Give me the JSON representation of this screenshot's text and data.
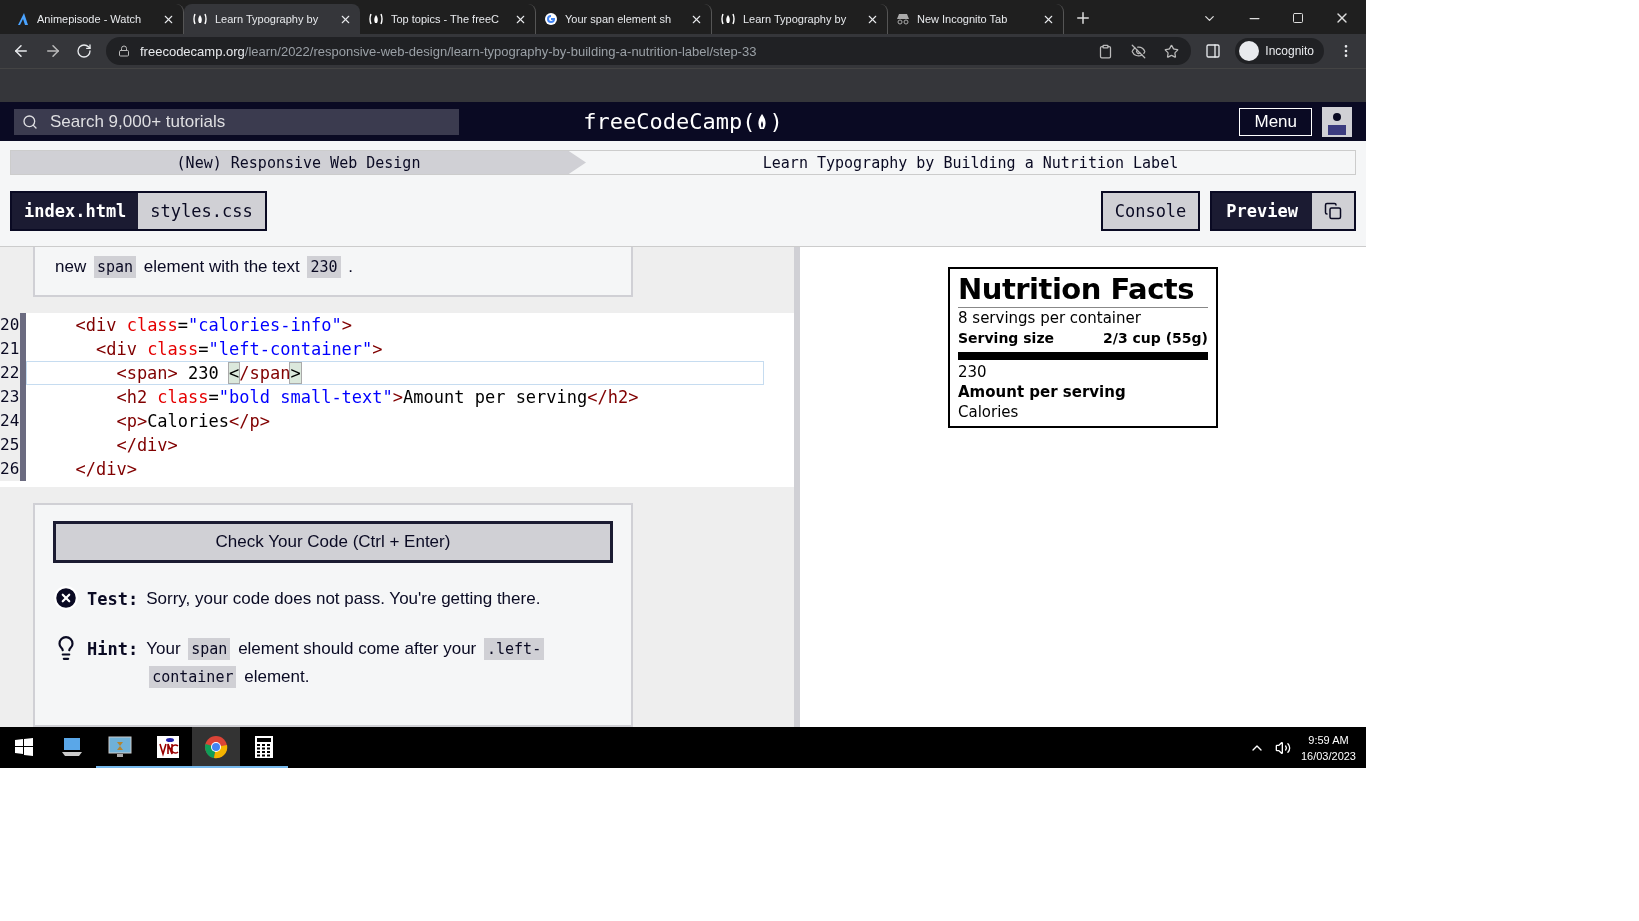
{
  "browser": {
    "tabs": [
      {
        "title": "Animepisode - Watch",
        "kind": "a",
        "selected": false
      },
      {
        "title": "Learn Typography by",
        "kind": "fcc",
        "selected": true
      },
      {
        "title": "Top topics - The freeC",
        "kind": "fcc",
        "selected": false
      },
      {
        "title": "Your span element sh",
        "kind": "g",
        "selected": false
      },
      {
        "title": "Learn Typography by",
        "kind": "fcc",
        "selected": false
      },
      {
        "title": "New Incognito Tab",
        "kind": "incognito",
        "selected": false
      }
    ],
    "url_domain": "freecodecamp.org",
    "url_path": "/learn/2022/responsive-web-design/learn-typography-by-building-a-nutrition-label/step-33",
    "profile": "Incognito"
  },
  "site": {
    "search_placeholder": "Search 9,000+ tutorials",
    "logo": "freeCodeCamp(",
    "logo_close": ")",
    "menu": "Menu"
  },
  "breadcrumb": [
    {
      "label": "(New) Responsive Web Design"
    },
    {
      "label": "Learn Typography by Building a Nutrition Label"
    }
  ],
  "file_tabs": [
    {
      "label": "index.html",
      "selected": true
    },
    {
      "label": "styles.css",
      "selected": false
    }
  ],
  "actions": {
    "console": "Console",
    "preview": "Preview"
  },
  "instructions": {
    "parts": [
      {
        "kind": "text",
        "text": "new"
      },
      {
        "kind": "code",
        "text": "span"
      },
      {
        "kind": "text",
        "text": "element with the text"
      },
      {
        "kind": "code",
        "text": "230"
      },
      {
        "kind": "text",
        "text": "."
      }
    ]
  },
  "code_lines": [
    {
      "number": "20",
      "active": false,
      "tokens": [
        {
          "kind": "tag",
          "text": "  <div"
        },
        {
          "kind": "attr",
          "text": " class"
        },
        {
          "kind": "plain",
          "text": "="
        },
        {
          "kind": "string",
          "text": "\"calories-info\""
        },
        {
          "kind": "tag",
          "text": ">"
        }
      ]
    },
    {
      "number": "21",
      "active": false,
      "tokens": [
        {
          "kind": "tag",
          "text": "    <div"
        },
        {
          "kind": "attr",
          "text": " class"
        },
        {
          "kind": "plain",
          "text": "="
        },
        {
          "kind": "string",
          "text": "\"left-container\""
        },
        {
          "kind": "tag",
          "text": ">"
        }
      ]
    },
    {
      "number": "22",
      "active": true,
      "tokens": [
        {
          "kind": "tag",
          "text": "      <span>"
        },
        {
          "kind": "plain",
          "text": " 230 "
        },
        {
          "kind": "bracket",
          "text": "<"
        },
        {
          "kind": "tag",
          "text": "/span"
        },
        {
          "kind": "bracket",
          "text": ">"
        }
      ]
    },
    {
      "number": "23",
      "active": false,
      "tokens": [
        {
          "kind": "tag",
          "text": "      <h2"
        },
        {
          "kind": "attr",
          "text": " class"
        },
        {
          "kind": "plain",
          "text": "="
        },
        {
          "kind": "string",
          "text": "\"bold small-text\""
        },
        {
          "kind": "tag",
          "text": ">"
        },
        {
          "kind": "plain",
          "text": "Amount per serving"
        },
        {
          "kind": "tag",
          "text": "</h2>"
        }
      ]
    },
    {
      "number": "24",
      "active": false,
      "tokens": [
        {
          "kind": "tag",
          "text": "      <p>"
        },
        {
          "kind": "plain",
          "text": "Calories"
        },
        {
          "kind": "tag",
          "text": "</p>"
        }
      ]
    },
    {
      "number": "25",
      "active": false,
      "tokens": [
        {
          "kind": "tag",
          "text": "      </div>"
        }
      ]
    },
    {
      "number": "26",
      "active": false,
      "tokens": [
        {
          "kind": "tag",
          "text": "  </div>"
        }
      ]
    }
  ],
  "check_button": "Check Your Code (Ctrl + Enter)",
  "feedback": [
    {
      "kind": "test",
      "label": "Test:",
      "parts": [
        {
          "kind": "text",
          "text": "Sorry, your code does not pass. You're getting there."
        }
      ]
    },
    {
      "kind": "hint",
      "label": "Hint:",
      "parts": [
        {
          "kind": "text",
          "text": "Your"
        },
        {
          "kind": "code",
          "text": "span"
        },
        {
          "kind": "text",
          "text": "element should come after your"
        },
        {
          "kind": "code",
          "text": ".left-"
        },
        {
          "kind": "code",
          "text": "container"
        },
        {
          "kind": "text",
          "text": "element."
        }
      ]
    }
  ],
  "preview": {
    "title": "Nutrition Facts",
    "servings": "8 servings per container",
    "serving_label": "Serving size",
    "serving_value": "2/3 cup (55g)",
    "calories_number": "230",
    "amount_label": "Amount per serving",
    "calories_label": "Calories"
  },
  "taskbar": {
    "apps": [
      {
        "kind": "computer",
        "running": false,
        "active": false
      },
      {
        "kind": "monitor",
        "running": true,
        "active": false
      },
      {
        "kind": "vnc",
        "running": true,
        "active": false
      },
      {
        "kind": "chrome",
        "running": true,
        "active": true
      },
      {
        "kind": "calculator",
        "running": true,
        "active": false
      }
    ],
    "time": "9:59 AM",
    "date": "16/03/2023"
  }
}
